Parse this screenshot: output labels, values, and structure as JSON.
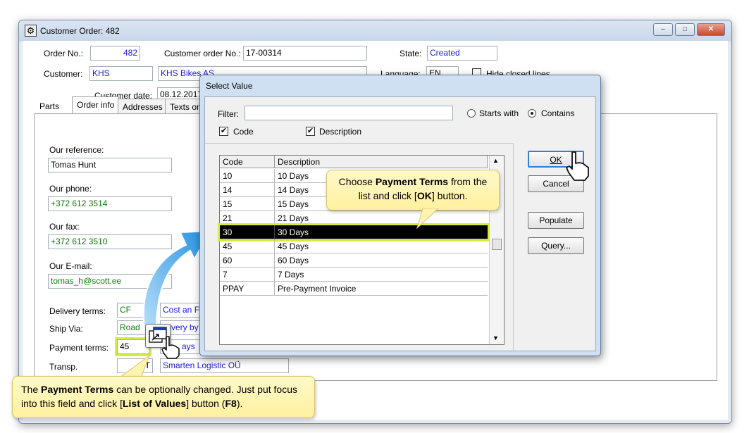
{
  "window": {
    "title": "Customer Order: 482",
    "controls": {
      "minimize": "–",
      "maximize": "□",
      "close": "✕"
    }
  },
  "header": {
    "order_no_label": "Order No.:",
    "order_no": "482",
    "customer_order_no_label": "Customer order No.:",
    "customer_order_no": "17-00314",
    "state_label": "State:",
    "state": "Created",
    "customer_label": "Customer:",
    "customer_code": "KHS",
    "customer_name": "KHS Bikes AS",
    "language_label": "Language:",
    "language": "EN",
    "hide_closed_lines_label": "Hide closed lines",
    "customer_date_label": "Customer date:",
    "customer_date": "08.12.2017"
  },
  "tabs": [
    "Parts",
    "Order info",
    "Addresses",
    "Texts on"
  ],
  "order_info": {
    "our_reference_label": "Our reference:",
    "our_reference": "Tomas Hunt",
    "our_phone_label": "Our phone:",
    "our_phone": "+372 612 3514",
    "our_fax_label": "Our fax:",
    "our_fax": "+372 612 3510",
    "our_email_label": "Our E-mail:",
    "our_email": "tomas_h@scott.ee",
    "delivery_terms_label": "Delivery terms:",
    "delivery_terms_code": "CF",
    "delivery_terms_desc": "Cost an Fr",
    "ship_via_label": "Ship Via:",
    "ship_via_code": "Road",
    "ship_via_desc": "elivery by",
    "payment_terms_label": "Payment terms:",
    "payment_terms_code": "45",
    "payment_terms_desc": "ays",
    "transport_label": "Transp.",
    "transport_code": "RT",
    "transport_desc": "Smarten Logistic OÜ"
  },
  "dialog": {
    "title": "Select Value",
    "filter_label": "Filter:",
    "filter_value": "",
    "starts_with_label": "Starts with",
    "contains_label": "Contains",
    "code_checkbox_label": "Code",
    "description_checkbox_label": "Description",
    "columns": [
      "Code",
      "Description"
    ],
    "rows": [
      {
        "code": "10",
        "desc": "10 Days"
      },
      {
        "code": "14",
        "desc": "14 Days"
      },
      {
        "code": "15",
        "desc": "15 Days"
      },
      {
        "code": "21",
        "desc": "21 Days"
      },
      {
        "code": "30",
        "desc": "30 Days"
      },
      {
        "code": "45",
        "desc": "45 Days"
      },
      {
        "code": "60",
        "desc": "60 Days"
      },
      {
        "code": "7",
        "desc": "7 Days"
      },
      {
        "code": "PPAY",
        "desc": "Pre-Payment Invoice"
      }
    ],
    "ok_label": "OK",
    "cancel_label": "Cancel",
    "populate_label": "Populate",
    "query_label": "Query..."
  },
  "callouts": {
    "top": {
      "part1": "Choose ",
      "bold1": "Payment Terms",
      "part2": " from the list and click [",
      "bold2": "OK",
      "part3": "] button."
    },
    "bottom": {
      "part1": "The ",
      "bold1": "Payment Terms",
      "part2": " can be optionally changed.  Just put focus into this field and click [",
      "bold2": "List of Values",
      "part3": "] button (",
      "bold3": "F8",
      "part4": ")."
    }
  },
  "icons": [
    "app-icon",
    "list-of-values-icon",
    "hand-cursor-icon",
    "blue-arrow-icon"
  ],
  "colors": {
    "selection_highlight": "#d6ec3b",
    "callout_fill": "#fff4b0",
    "arrow": "#2f9ae0",
    "field_text": "#1a1ae0"
  }
}
